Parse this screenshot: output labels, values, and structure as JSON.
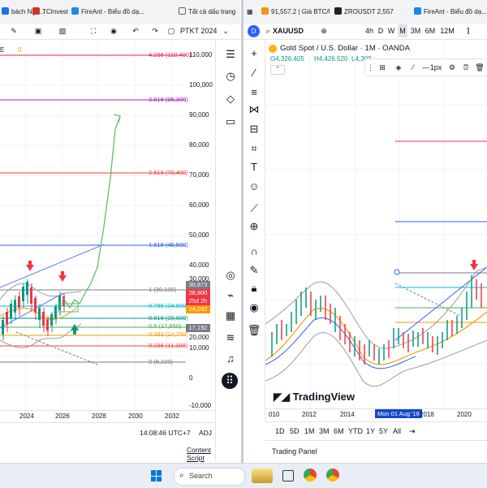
{
  "browser_left": {
    "tabs": [
      {
        "label": "bách Ngu...",
        "color": "#1a73e8"
      },
      {
        "label": "TCInvest",
        "color": "#d93025"
      },
      {
        "label": "FireAnt - Biểu đồ dạ...",
        "color": "#1e88e5"
      },
      {
        "label": "Tất cả dấu trang",
        "color": "#5f6368"
      }
    ]
  },
  "browser_right": {
    "tabs": [
      {
        "label": "91,557.2 | Giá BTC/U...",
        "color": "#f7931a"
      },
      {
        "label": "ZROUSDT 2,557",
        "color": "#202124"
      },
      {
        "label": "FireAnt - Biểu đồ dạ...",
        "color": "#1e88e5"
      }
    ]
  },
  "left_chart": {
    "toolbar": {
      "title": "PTKT 2024"
    },
    "legend_suffix": "E",
    "legend_zero": "0",
    "price_axis": [
      "110,000",
      "100,000",
      "90,000",
      "80,000",
      "70,000",
      "60,000",
      "50,000",
      "40,000",
      "30,000",
      "20,000",
      "10,000",
      "0",
      "-10,000"
    ],
    "fib_levels": [
      {
        "label": "4.236 (110,400)",
        "color": "#e91e63"
      },
      {
        "label": "3.618 (95,300)",
        "color": "#9c27b0"
      },
      {
        "label": "2.618 (70,400)",
        "color": "#f44336"
      },
      {
        "label": "1.618 (45,500)",
        "color": "#2962ff"
      },
      {
        "label": "1 (30,100)",
        "color": "#787b86"
      },
      {
        "label": "0.786 (24,800)",
        "color": "#00bcd4"
      },
      {
        "label": "0.618 (20,600)",
        "color": "#009688"
      },
      {
        "label": "0.5 (17,650)",
        "color": "#4caf50"
      },
      {
        "label": "0.382 (14,750)",
        "color": "#ff9800"
      },
      {
        "label": "0.236 (11,100)",
        "color": "#f44336"
      },
      {
        "label": "0 (5,220)",
        "color": "#787b86"
      }
    ],
    "price_tags": [
      {
        "text": "30,873",
        "color": "#787b86"
      },
      {
        "text": "28,800",
        "color": "#f23645"
      },
      {
        "text": "25d 2h",
        "color": "#f23645"
      },
      {
        "text": "24,032",
        "color": "#ff9800"
      },
      {
        "text": "17,192",
        "color": "#787b86"
      }
    ],
    "time_axis": [
      "2024",
      "2026",
      "2028",
      "2030",
      "2032"
    ],
    "clock": "14:08:46 UTC+7",
    "adj": "ADJ",
    "content_script": "Content Script"
  },
  "right_chart": {
    "symbol": "XAUUSD",
    "intervals": [
      "4h",
      "D",
      "W",
      "M",
      "3M",
      "6M",
      "12M"
    ],
    "title": "Gold Spot / U.S. Dollar · 1M · OANDA",
    "ohlc": {
      "o": "O4,326.405",
      "h": "H4,426.520",
      "l": "L4,309"
    },
    "zoom_label": "1px",
    "time_axis": [
      "010",
      "2012",
      "2014",
      "2018",
      "2020"
    ],
    "crosshair_date": "Mon 01 Aug '16",
    "ranges": [
      "1D",
      "5D",
      "1M",
      "3M",
      "6M",
      "YTD",
      "1Y",
      "5Y",
      "All"
    ],
    "trading_panel": "Trading Panel",
    "logo_text": "TradingView"
  },
  "taskbar": {
    "search_placeholder": "Search"
  }
}
